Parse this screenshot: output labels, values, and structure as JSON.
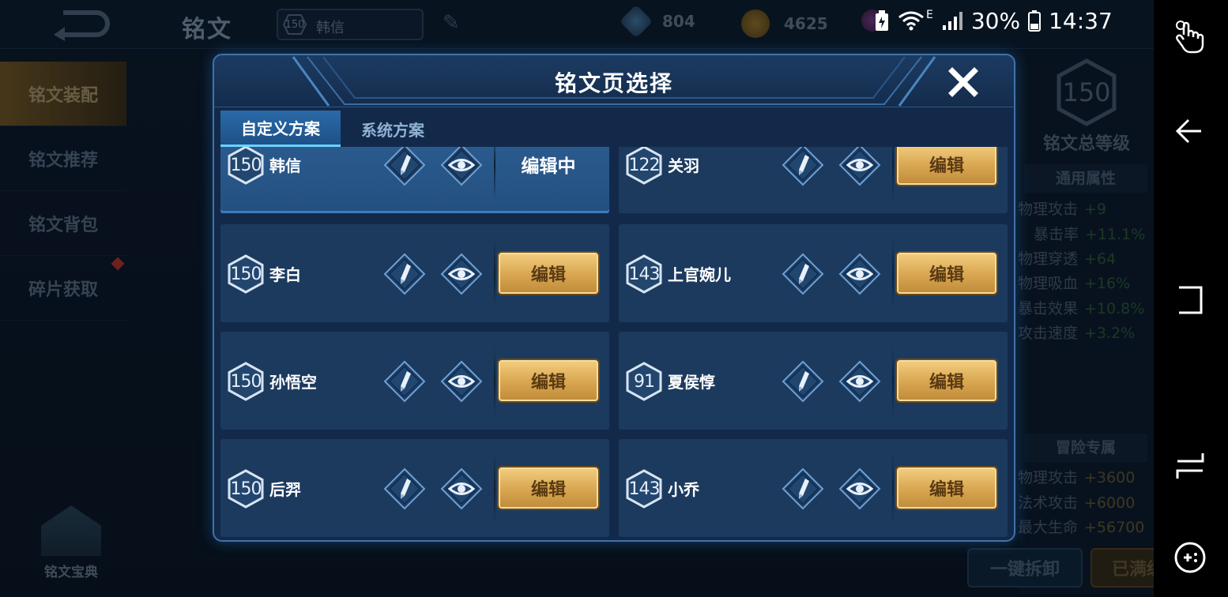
{
  "background": {
    "title": "铭文",
    "current_plan": {
      "level": "150",
      "name": "韩信"
    },
    "resources": [
      "804",
      "4625"
    ],
    "left_menu": [
      "铭文装配",
      "铭文推荐",
      "铭文背包",
      "碎片获取"
    ],
    "codex_label": "铭文宝典",
    "total_level": "150",
    "total_level_label": "铭文总等级",
    "general_title": "通用属性",
    "general_stats": [
      {
        "name": "物理攻击",
        "value": "+9"
      },
      {
        "name": "暴击率",
        "value": "+11.1%"
      },
      {
        "name": "物理穿透",
        "value": "+64"
      },
      {
        "name": "物理吸血",
        "value": "+16%"
      },
      {
        "name": "暴击效果",
        "value": "+10.8%"
      },
      {
        "name": "攻击速度",
        "value": "+3.2%"
      }
    ],
    "adventure_title": "冒险专属",
    "adventure_stats": [
      {
        "name": "物理攻击",
        "value": "+3600"
      },
      {
        "name": "法术攻击",
        "value": "+6000"
      },
      {
        "name": "最大生命",
        "value": "+56700"
      }
    ],
    "dismantle_label": "一键拆卸",
    "maxed_label": "已满级"
  },
  "status_bar": {
    "battery": "30%",
    "time": "14:37",
    "network": "E"
  },
  "modal": {
    "title": "铭文页选择",
    "tabs": [
      {
        "label": "自定义方案",
        "active": true
      },
      {
        "label": "系统方案",
        "active": false
      }
    ],
    "edit_label": "编辑",
    "editing_label": "编辑中",
    "plans": [
      {
        "level": "150",
        "name": "韩信",
        "editing": true
      },
      {
        "level": "122",
        "name": "关羽",
        "editing": false
      },
      {
        "level": "150",
        "name": "李白",
        "editing": false
      },
      {
        "level": "143",
        "name": "上官婉儿",
        "editing": false
      },
      {
        "level": "150",
        "name": "孙悟空",
        "editing": false
      },
      {
        "level": "91",
        "name": "夏侯惇",
        "editing": false
      },
      {
        "level": "150",
        "name": "后羿",
        "editing": false
      },
      {
        "level": "143",
        "name": "小乔",
        "editing": false
      }
    ]
  },
  "icons": {
    "close": "close-icon",
    "pencil": "pencil-icon",
    "eye": "eye-icon",
    "level_badge": "hexagon-badge-icon"
  },
  "colors": {
    "accent_gold": "#d8a550",
    "modal_bg": "#13294a",
    "card_bg": "#1c3a5e",
    "card_editing": "#2b5a8e",
    "tab_active": "#2a6aa8"
  }
}
